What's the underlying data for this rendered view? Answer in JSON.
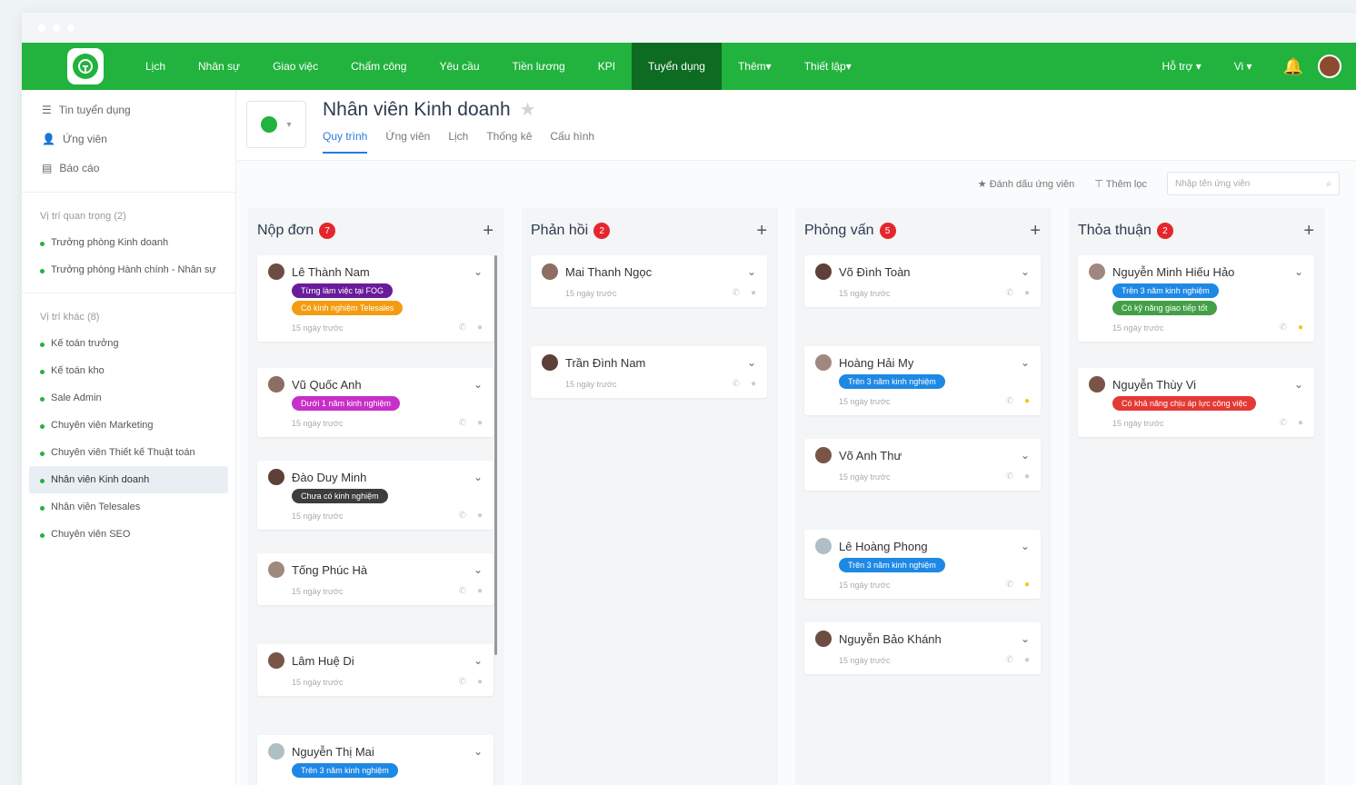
{
  "nav": {
    "items": [
      "Lịch",
      "Nhân sự",
      "Giao việc",
      "Chấm công",
      "Yêu cầu",
      "Tiền lương",
      "KPI",
      "Tuyển dụng",
      "Thêm",
      "Thiết lập"
    ],
    "active": "Tuyển dụng",
    "right": [
      "Hỗ trợ",
      "Vi"
    ]
  },
  "sidebar": {
    "links": [
      "Tin tuyển dụng",
      "Ứng viên",
      "Báo cáo"
    ],
    "group1_title": "Vị trí quan trọng (2)",
    "group1": [
      "Trưởng phòng Kinh doanh",
      "Trưởng phòng Hành chính - Nhân sự"
    ],
    "group2_title": "Vị trí khác (8)",
    "group2": [
      "Kế toán trưởng",
      "Kế toán kho",
      "Sale Admin",
      "Chuyên viên Marketing",
      "Chuyên viên Thiết kế Thuật toán",
      "Nhân viên Kinh doanh",
      "Nhân viên Telesales",
      "Chuyên viên SEO"
    ],
    "active": "Nhân viên Kinh doanh"
  },
  "job": {
    "title": "Nhân viên Kinh doanh",
    "tabs": [
      "Quy trình",
      "Ứng viên",
      "Lịch",
      "Thống kê",
      "Cấu hình"
    ],
    "active_tab": "Quy trình"
  },
  "toolbar": {
    "mark": "Đánh dấu ứng viên",
    "filter": "Thêm lọc",
    "search_placeholder": "Nhập tên ứng viên"
  },
  "columns": [
    {
      "title": "Nộp đơn",
      "count": "7",
      "cards": [
        {
          "name": "Lê Thành Nam",
          "tags": [
            {
              "text": "Từng làm việc tại FOG",
              "color": "#6a1b9a"
            },
            {
              "text": "Có kinh nghiệm Telesales",
              "color": "#f39c12"
            }
          ],
          "time": "15 ngày trước",
          "star": false
        },
        {
          "name": "Vũ Quốc Anh",
          "tags": [
            {
              "text": "Dưới 1 năm kinh nghiệm",
              "color": "#c730c8"
            }
          ],
          "time": "15 ngày trước",
          "star": false
        },
        {
          "name": "Đào Duy Minh",
          "tags": [
            {
              "text": "Chưa có kinh nghiệm",
              "color": "#3d3d3d"
            }
          ],
          "time": "15 ngày trước",
          "star": false
        },
        {
          "name": "Tống Phúc Hà",
          "tags": [],
          "time": "15 ngày trước",
          "star": false
        },
        {
          "name": "Lâm Huệ Di",
          "tags": [],
          "time": "15 ngày trước",
          "star": false
        },
        {
          "name": "Nguyễn Thị Mai",
          "tags": [
            {
              "text": "Trên 3 năm kinh nghiệm",
              "color": "#1e88e5"
            }
          ],
          "time": "",
          "star": false
        }
      ]
    },
    {
      "title": "Phản hồi",
      "count": "2",
      "cards": [
        {
          "name": "Mai Thanh Ngọc",
          "tags": [],
          "time": "15 ngày trước",
          "star": false
        },
        {
          "name": "Trần Đình Nam",
          "tags": [],
          "time": "15 ngày trước",
          "star": false
        }
      ]
    },
    {
      "title": "Phỏng vấn",
      "count": "5",
      "cards": [
        {
          "name": "Võ Đình Toàn",
          "tags": [],
          "time": "15 ngày trước",
          "star": false
        },
        {
          "name": "Hoàng Hải My",
          "tags": [
            {
              "text": "Trên 3 năm kinh nghiệm",
              "color": "#1e88e5"
            }
          ],
          "time": "15 ngày trước",
          "star": true
        },
        {
          "name": "Võ Anh Thư",
          "tags": [],
          "time": "15 ngày trước",
          "star": false
        },
        {
          "name": "Lê Hoàng Phong",
          "tags": [
            {
              "text": "Trên 3 năm kinh nghiệm",
              "color": "#1e88e5"
            }
          ],
          "time": "15 ngày trước",
          "star": true
        },
        {
          "name": "Nguyễn Bảo Khánh",
          "tags": [],
          "time": "15 ngày trước",
          "star": false
        }
      ]
    },
    {
      "title": "Thỏa thuận",
      "count": "2",
      "cards": [
        {
          "name": "Nguyễn Minh Hiếu Hảo",
          "tags": [
            {
              "text": "Trên 3 năm kinh nghiệm",
              "color": "#1e88e5"
            },
            {
              "text": "Có kỹ năng giao tiếp tốt",
              "color": "#43a047"
            }
          ],
          "time": "15 ngày trước",
          "star": true
        },
        {
          "name": "Nguyễn Thùy Vi",
          "tags": [
            {
              "text": "Có khả năng chịu áp lực công việc",
              "color": "#e53935"
            }
          ],
          "time": "15 ngày trước",
          "star": false
        }
      ]
    }
  ]
}
